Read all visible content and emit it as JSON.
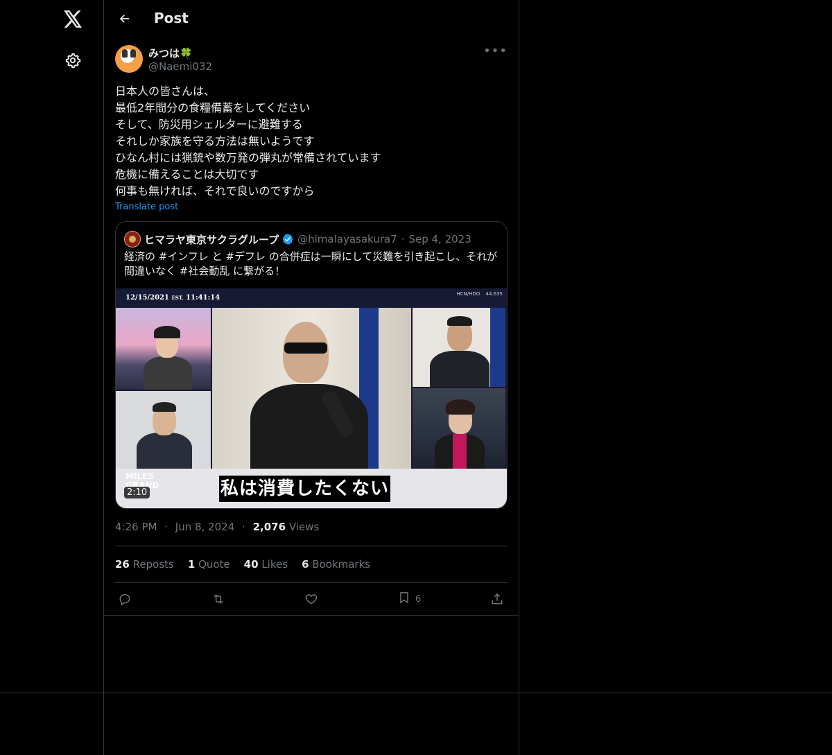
{
  "header": {
    "title": "Post"
  },
  "author": {
    "display_name": "みつは🍀",
    "handle": "@Naemi032"
  },
  "post": {
    "text": "日本人の皆さんは、\n最低2年間分の食糧備蓄をしてください\nそして、防災用シェルターに避難する\nそれしか家族を守る方法は無いようです\nひなん村には猟銃や数万発の弾丸が常備されています\n危機に備えることは大切です\n何事も無ければ、それで良いのですから",
    "translate_label": "Translate post",
    "time": "4:26 PM",
    "date": "Jun 8, 2024",
    "views_count": "2,076",
    "views_label": "Views"
  },
  "quote": {
    "display_name": "ヒマラヤ東京サクラグループ",
    "handle": "@himalayasakura7",
    "date": "Sep 4, 2023",
    "text": "経済の #インフレ と #デフレ の合併症は一瞬にして災難を引き起こし、それが間違いなく #社会動乱 に繋がる！",
    "video": {
      "timestamp": "12/15/2021",
      "timestamp_tz": "EST.",
      "timestamp_time": "11:41:14",
      "ticker_symbol": "HCN/HDO",
      "ticker_value": "44.635",
      "caption": "私は消費したくない",
      "watermark": "MILES\nGRAND",
      "duration": "2:10"
    }
  },
  "stats": [
    {
      "count": "26",
      "label": "Reposts"
    },
    {
      "count": "1",
      "label": "Quote"
    },
    {
      "count": "40",
      "label": "Likes"
    },
    {
      "count": "6",
      "label": "Bookmarks"
    }
  ],
  "actions": {
    "bookmark_count": "6"
  },
  "colors": {
    "background": "#000000",
    "border": "#2f3336",
    "secondary_text": "#71767b",
    "link": "#1d9bf0",
    "verified": "#1d9bf0"
  },
  "icons": [
    "x-logo-icon",
    "settings-gear-icon",
    "back-arrow-icon",
    "more-icon",
    "verified-badge-icon",
    "reply-icon",
    "repost-icon",
    "like-icon",
    "bookmark-icon",
    "share-icon"
  ]
}
